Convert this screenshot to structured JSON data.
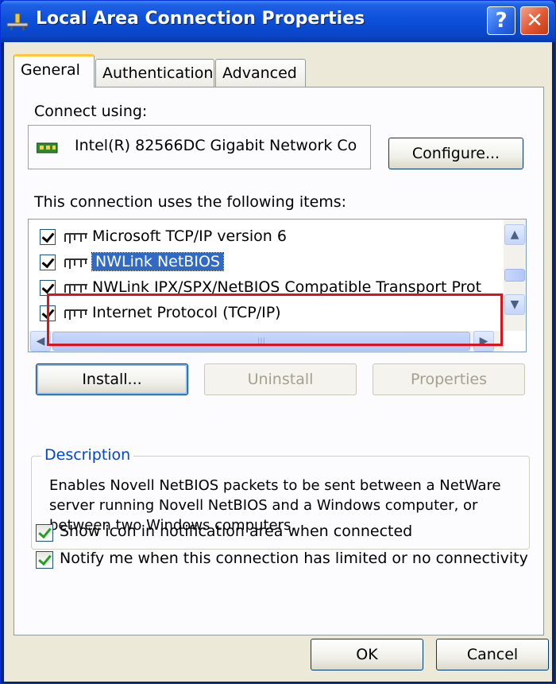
{
  "window": {
    "title": "Local Area Connection Properties",
    "help_label": "?",
    "close_label": "✕"
  },
  "tabs": [
    {
      "label": "General",
      "active": true
    },
    {
      "label": "Authentication",
      "active": false
    },
    {
      "label": "Advanced",
      "active": false
    }
  ],
  "general": {
    "connect_using_label": "Connect using:",
    "adapter_name": "Intel(R) 82566DC Gigabit Network Co",
    "configure_label": "Configure...",
    "items_label": "This connection uses the following items:",
    "items": [
      {
        "label": "Microsoft TCP/IP version 6",
        "checked": true,
        "selected": false
      },
      {
        "label": "NWLink NetBIOS",
        "checked": true,
        "selected": true
      },
      {
        "label": "NWLink IPX/SPX/NetBIOS Compatible Transport Prot",
        "checked": true,
        "selected": false
      },
      {
        "label": "Internet Protocol (TCP/IP)",
        "checked": true,
        "selected": false
      }
    ],
    "install_label": "Install...",
    "uninstall_label": "Uninstall",
    "properties_label": "Properties",
    "description_legend": "Description",
    "description_text": "Enables Novell NetBIOS packets to be sent between a NetWare server running Novell NetBIOS and a Windows computer, or between two Windows computers.",
    "show_icon_label": "Show icon in notification area when connected",
    "show_icon_checked": true,
    "notify_label": "Notify me when this connection has limited or no connectivity",
    "notify_checked": true
  },
  "footer": {
    "ok_label": "OK",
    "cancel_label": "Cancel"
  },
  "colors": {
    "title_bar": "#0b4fd8",
    "dialog_face": "#ece9d8",
    "selection": "#316ac5",
    "highlight_box": "#d9141c"
  }
}
